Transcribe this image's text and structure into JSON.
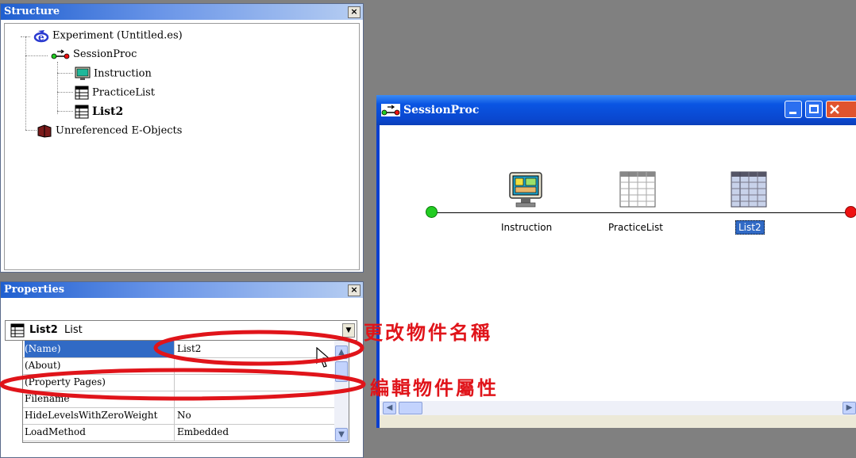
{
  "structure": {
    "title": "Structure",
    "close_glyph": "×",
    "tree": {
      "experiment": "Experiment (Untitled.es)",
      "session_proc": "SessionProc",
      "instruction": "Instruction",
      "practice_list": "PracticeList",
      "list2": "List2",
      "unreferenced": "Unreferenced E-Objects"
    }
  },
  "properties": {
    "title": "Properties",
    "close_glyph": "×",
    "selected_object_name": "List2",
    "selected_object_type": "List",
    "rows": [
      {
        "key": "(Name)",
        "value": "List2"
      },
      {
        "key": "(About)",
        "value": ""
      },
      {
        "key": "(Property Pages)",
        "value": ""
      },
      {
        "key": "Filename",
        "value": ""
      },
      {
        "key": "HideLevelsWithZeroWeight",
        "value": "No"
      },
      {
        "key": "LoadMethod",
        "value": "Embedded"
      }
    ]
  },
  "session_window": {
    "title": "SessionProc",
    "nodes": {
      "instruction": "Instruction",
      "practice_list": "PracticeList",
      "list2": "List2"
    }
  },
  "annotations": {
    "rename": "更改物件名稱",
    "edit_props": "編輯物件屬性"
  },
  "colors": {
    "annotation_red": "#e0141a",
    "selection_blue": "#316ac5",
    "start_node": "#22cc22",
    "end_node": "#ee1111"
  }
}
